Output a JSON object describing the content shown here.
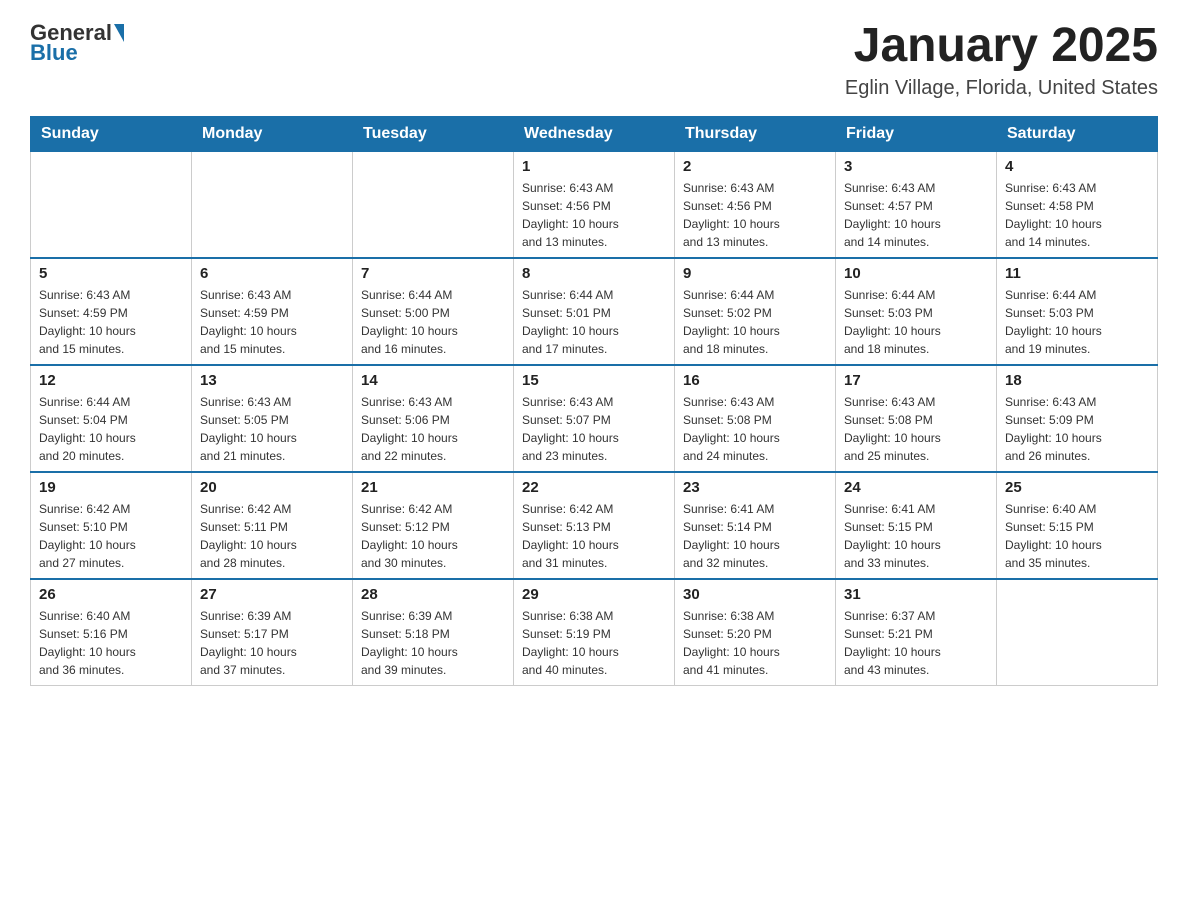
{
  "header": {
    "logo_general": "General",
    "logo_blue": "Blue",
    "month_title": "January 2025",
    "location": "Eglin Village, Florida, United States"
  },
  "weekdays": [
    "Sunday",
    "Monday",
    "Tuesday",
    "Wednesday",
    "Thursday",
    "Friday",
    "Saturday"
  ],
  "weeks": [
    [
      {
        "day": "",
        "info": ""
      },
      {
        "day": "",
        "info": ""
      },
      {
        "day": "",
        "info": ""
      },
      {
        "day": "1",
        "info": "Sunrise: 6:43 AM\nSunset: 4:56 PM\nDaylight: 10 hours\nand 13 minutes."
      },
      {
        "day": "2",
        "info": "Sunrise: 6:43 AM\nSunset: 4:56 PM\nDaylight: 10 hours\nand 13 minutes."
      },
      {
        "day": "3",
        "info": "Sunrise: 6:43 AM\nSunset: 4:57 PM\nDaylight: 10 hours\nand 14 minutes."
      },
      {
        "day": "4",
        "info": "Sunrise: 6:43 AM\nSunset: 4:58 PM\nDaylight: 10 hours\nand 14 minutes."
      }
    ],
    [
      {
        "day": "5",
        "info": "Sunrise: 6:43 AM\nSunset: 4:59 PM\nDaylight: 10 hours\nand 15 minutes."
      },
      {
        "day": "6",
        "info": "Sunrise: 6:43 AM\nSunset: 4:59 PM\nDaylight: 10 hours\nand 15 minutes."
      },
      {
        "day": "7",
        "info": "Sunrise: 6:44 AM\nSunset: 5:00 PM\nDaylight: 10 hours\nand 16 minutes."
      },
      {
        "day": "8",
        "info": "Sunrise: 6:44 AM\nSunset: 5:01 PM\nDaylight: 10 hours\nand 17 minutes."
      },
      {
        "day": "9",
        "info": "Sunrise: 6:44 AM\nSunset: 5:02 PM\nDaylight: 10 hours\nand 18 minutes."
      },
      {
        "day": "10",
        "info": "Sunrise: 6:44 AM\nSunset: 5:03 PM\nDaylight: 10 hours\nand 18 minutes."
      },
      {
        "day": "11",
        "info": "Sunrise: 6:44 AM\nSunset: 5:03 PM\nDaylight: 10 hours\nand 19 minutes."
      }
    ],
    [
      {
        "day": "12",
        "info": "Sunrise: 6:44 AM\nSunset: 5:04 PM\nDaylight: 10 hours\nand 20 minutes."
      },
      {
        "day": "13",
        "info": "Sunrise: 6:43 AM\nSunset: 5:05 PM\nDaylight: 10 hours\nand 21 minutes."
      },
      {
        "day": "14",
        "info": "Sunrise: 6:43 AM\nSunset: 5:06 PM\nDaylight: 10 hours\nand 22 minutes."
      },
      {
        "day": "15",
        "info": "Sunrise: 6:43 AM\nSunset: 5:07 PM\nDaylight: 10 hours\nand 23 minutes."
      },
      {
        "day": "16",
        "info": "Sunrise: 6:43 AM\nSunset: 5:08 PM\nDaylight: 10 hours\nand 24 minutes."
      },
      {
        "day": "17",
        "info": "Sunrise: 6:43 AM\nSunset: 5:08 PM\nDaylight: 10 hours\nand 25 minutes."
      },
      {
        "day": "18",
        "info": "Sunrise: 6:43 AM\nSunset: 5:09 PM\nDaylight: 10 hours\nand 26 minutes."
      }
    ],
    [
      {
        "day": "19",
        "info": "Sunrise: 6:42 AM\nSunset: 5:10 PM\nDaylight: 10 hours\nand 27 minutes."
      },
      {
        "day": "20",
        "info": "Sunrise: 6:42 AM\nSunset: 5:11 PM\nDaylight: 10 hours\nand 28 minutes."
      },
      {
        "day": "21",
        "info": "Sunrise: 6:42 AM\nSunset: 5:12 PM\nDaylight: 10 hours\nand 30 minutes."
      },
      {
        "day": "22",
        "info": "Sunrise: 6:42 AM\nSunset: 5:13 PM\nDaylight: 10 hours\nand 31 minutes."
      },
      {
        "day": "23",
        "info": "Sunrise: 6:41 AM\nSunset: 5:14 PM\nDaylight: 10 hours\nand 32 minutes."
      },
      {
        "day": "24",
        "info": "Sunrise: 6:41 AM\nSunset: 5:15 PM\nDaylight: 10 hours\nand 33 minutes."
      },
      {
        "day": "25",
        "info": "Sunrise: 6:40 AM\nSunset: 5:15 PM\nDaylight: 10 hours\nand 35 minutes."
      }
    ],
    [
      {
        "day": "26",
        "info": "Sunrise: 6:40 AM\nSunset: 5:16 PM\nDaylight: 10 hours\nand 36 minutes."
      },
      {
        "day": "27",
        "info": "Sunrise: 6:39 AM\nSunset: 5:17 PM\nDaylight: 10 hours\nand 37 minutes."
      },
      {
        "day": "28",
        "info": "Sunrise: 6:39 AM\nSunset: 5:18 PM\nDaylight: 10 hours\nand 39 minutes."
      },
      {
        "day": "29",
        "info": "Sunrise: 6:38 AM\nSunset: 5:19 PM\nDaylight: 10 hours\nand 40 minutes."
      },
      {
        "day": "30",
        "info": "Sunrise: 6:38 AM\nSunset: 5:20 PM\nDaylight: 10 hours\nand 41 minutes."
      },
      {
        "day": "31",
        "info": "Sunrise: 6:37 AM\nSunset: 5:21 PM\nDaylight: 10 hours\nand 43 minutes."
      },
      {
        "day": "",
        "info": ""
      }
    ]
  ]
}
